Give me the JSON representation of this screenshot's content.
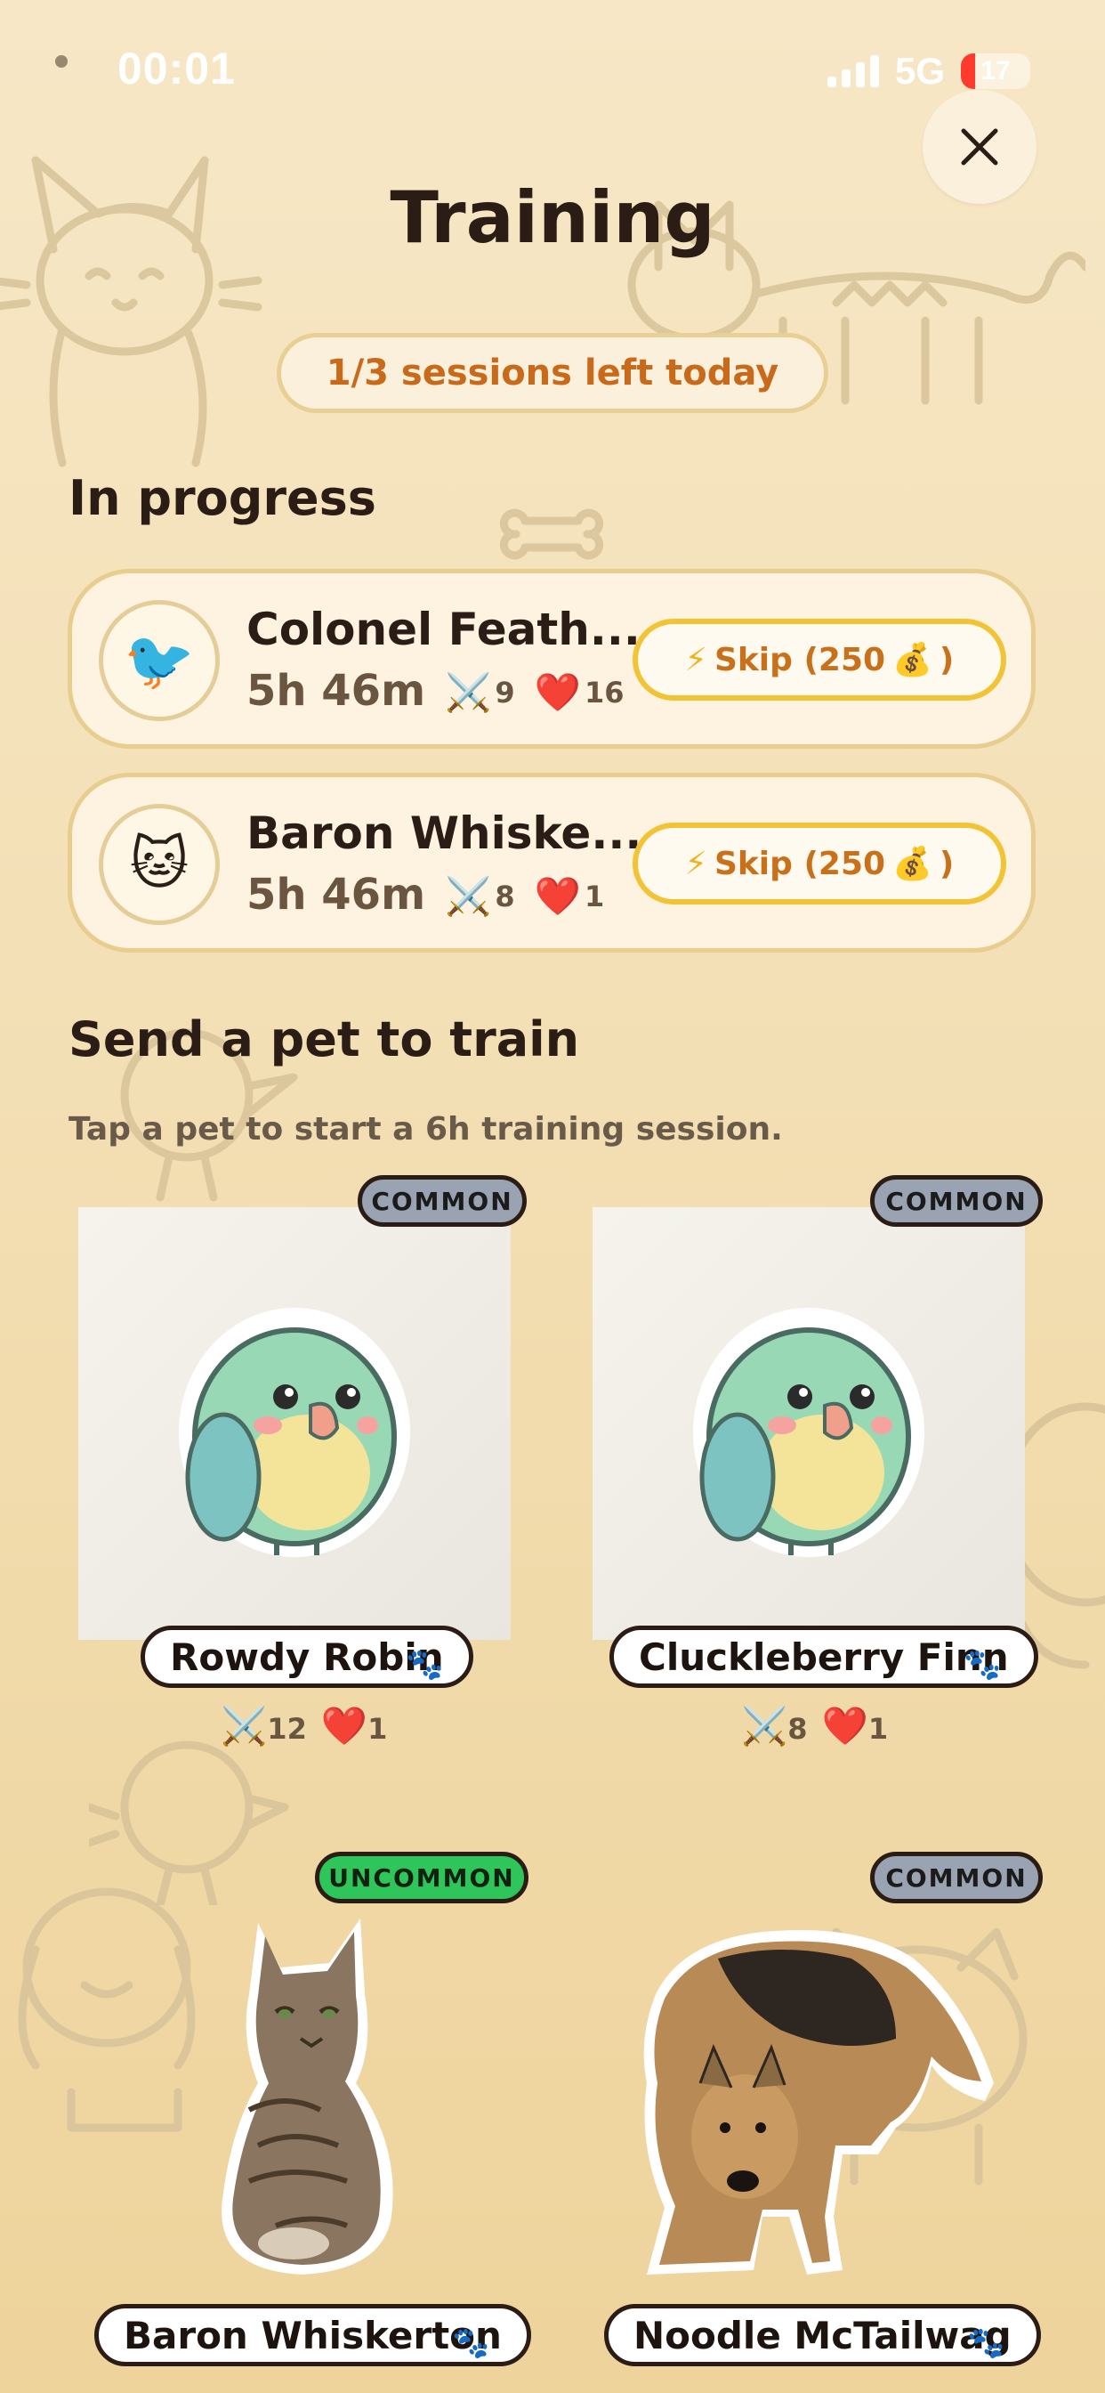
{
  "status_bar": {
    "time": "00:01",
    "network": "5G",
    "battery": "17"
  },
  "header": {
    "title": "Training",
    "close_icon": "close-icon"
  },
  "sessions": {
    "label": "1/3 sessions left today"
  },
  "in_progress": {
    "title": "In progress",
    "items": [
      {
        "name": "Colonel Feath...",
        "avatar": "🐦",
        "time": "5h 46m",
        "attack": "9",
        "health": "16",
        "skip_label": "Skip (250",
        "skip_coin": "💰",
        "skip_close": ")"
      },
      {
        "name": "Baron Whiske...",
        "avatar": "🐱",
        "time": "5h 46m",
        "attack": "8",
        "health": "1",
        "skip_label": "Skip (250",
        "skip_coin": "💰",
        "skip_close": ")"
      }
    ]
  },
  "send": {
    "title": "Send a pet to train",
    "subtitle": "Tap a pet to start a 6h training session.",
    "pets": [
      {
        "name": "Rowdy Robin",
        "rarity": "COMMON",
        "attack": "12",
        "health": "1",
        "image": "parakeet-sticker"
      },
      {
        "name": "Cluckleberry Finn",
        "rarity": "COMMON",
        "attack": "8",
        "health": "1",
        "image": "parakeet-sticker"
      },
      {
        "name": "Baron Whiskerton",
        "rarity": "UNCOMMON",
        "image": "tabby-cat-photo"
      },
      {
        "name": "Noodle McTailwag",
        "rarity": "COMMON",
        "image": "shepherd-dog-photo"
      }
    ]
  },
  "icons": {
    "attack": "⚔️",
    "health": "❤️",
    "bolt": "⚡",
    "paw": "🐾"
  },
  "colors": {
    "accent": "#c96a1a",
    "skip_border": "#f2c335",
    "uncommon": "#2ec65a",
    "common": "#9aa3b2"
  }
}
